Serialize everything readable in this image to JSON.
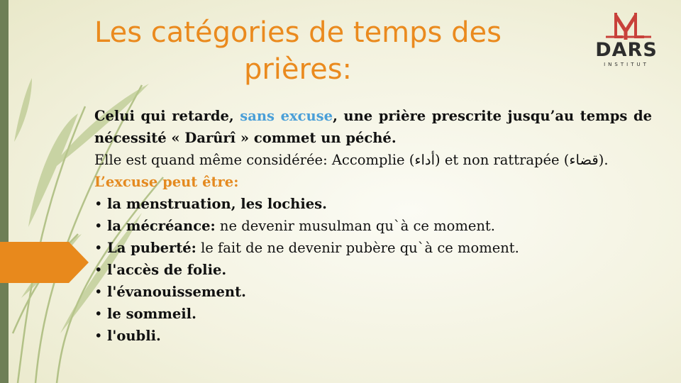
{
  "slide": {
    "title": "Les catégories de temps des prières:",
    "logo": {
      "word": "DARS",
      "sub": "INSTITUT"
    },
    "para1": {
      "part1": "Celui qui retarde, ",
      "highlight": "sans excuse",
      "part2": ", une prière prescrite jusqu’au temps de nécessité « Darûrî » commet un péché."
    },
    "para2": "Elle est quand même considérée: Accomplie (أداء) et non rattrapée (قضاء).",
    "excuse_heading": "L’excuse peut être:",
    "bullets": [
      {
        "bold": "la menstruation, les lochies.",
        "rest": ""
      },
      {
        "bold": "la mécréance:",
        "rest": " ne devenir musulman qu`à ce moment."
      },
      {
        "bold": "La puberté:",
        "rest": " le fait de ne devenir pubère qu`à ce moment."
      },
      {
        "bold": "l'accès de folie.",
        "rest": ""
      },
      {
        "bold": "l'évanouissement.",
        "rest": ""
      },
      {
        "bold": "le sommeil.",
        "rest": ""
      },
      {
        "bold": "l'oubli.",
        "rest": ""
      }
    ],
    "colors": {
      "title": "#ea8a1e",
      "accent_blue": "#4a9fd8",
      "heading_orange": "#e48a20",
      "logo_red": "#c8413a",
      "logo_dark": "#2d2d2d",
      "band_green": "#6e7f56",
      "arrow_orange": "#e8891c"
    }
  }
}
